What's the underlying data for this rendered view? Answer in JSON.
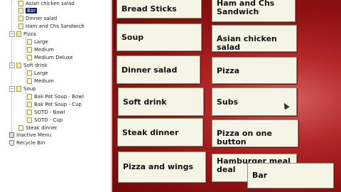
{
  "tree": {
    "items": [
      {
        "label": "Asian chicken salad"
      },
      {
        "label": "Bar"
      },
      {
        "label": "Dinner salad"
      },
      {
        "label": "Ham and Chs Sandwich"
      },
      {
        "label": "Pizza"
      },
      {
        "label": "Large"
      },
      {
        "label": "Medium"
      },
      {
        "label": "Medium Deluxe"
      },
      {
        "label": "Soft drink"
      },
      {
        "label": "Large"
      },
      {
        "label": "Medium"
      },
      {
        "label": "Soup"
      },
      {
        "label": "Bak Pot Soup - Bowl"
      },
      {
        "label": "Bak Pot Soup - Cup"
      },
      {
        "label": "SOTD - Bowl"
      },
      {
        "label": "SOTD - Cup"
      },
      {
        "label": "Steak dinner"
      },
      {
        "label": "Inactive Menu"
      },
      {
        "label": "Recycle Bin"
      }
    ]
  },
  "buttons": {
    "bread_sticks": "Bread Sticks",
    "ham_sandwich_line1": "Ham and Chs",
    "ham_sandwich_line2": "Sandwich",
    "soup": "Soup",
    "asian_salad": "Asian chicken salad",
    "dinner_salad": "Dinner salad",
    "pizza": "Pizza",
    "soft_drink": "Soft drink",
    "subs": "Subs",
    "steak_dinner": "Steak dinner",
    "pizza_one_button": "Pizza on one button",
    "pizza_wings": "Pizza and wings",
    "hamburger_line1": "Hamburger meal",
    "hamburger_line2": "deal",
    "bar": "Bar"
  },
  "colors": {
    "selection": "#0a246a",
    "canvas_red": "#b52828",
    "button_face": "#f5f5e6"
  }
}
